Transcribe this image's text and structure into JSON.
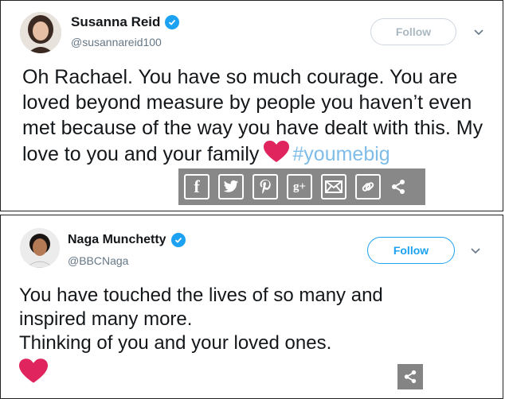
{
  "tweets": [
    {
      "name": "Susanna Reid",
      "handle": "@susannareid100",
      "follow_label": "Follow",
      "text_main": "Oh Rachael. You have so much courage. You are loved beyond measure by people you haven’t even met because of the way you have dealt with this. My love to you and your family",
      "hashtag": "#youmebig"
    },
    {
      "name": "Naga Munchetty",
      "handle": "@BBCNaga",
      "follow_label": "Follow",
      "lines": [
        "You have touched the lives of so many and",
        "inspired many more.",
        "Thinking of you and your loved ones."
      ]
    }
  ],
  "share_bar": {
    "facebook_glyph": "f",
    "google_plus_glyph": "g+"
  },
  "colors": {
    "accent": "#1da1f2",
    "heart": "#e0245e",
    "overlay": "#6e6e6e"
  },
  "icons": [
    "verified-badge-icon",
    "chevron-down-icon",
    "heart-icon",
    "facebook-icon",
    "twitter-icon",
    "pinterest-icon",
    "google-plus-icon",
    "email-icon",
    "link-icon",
    "share-icon"
  ]
}
